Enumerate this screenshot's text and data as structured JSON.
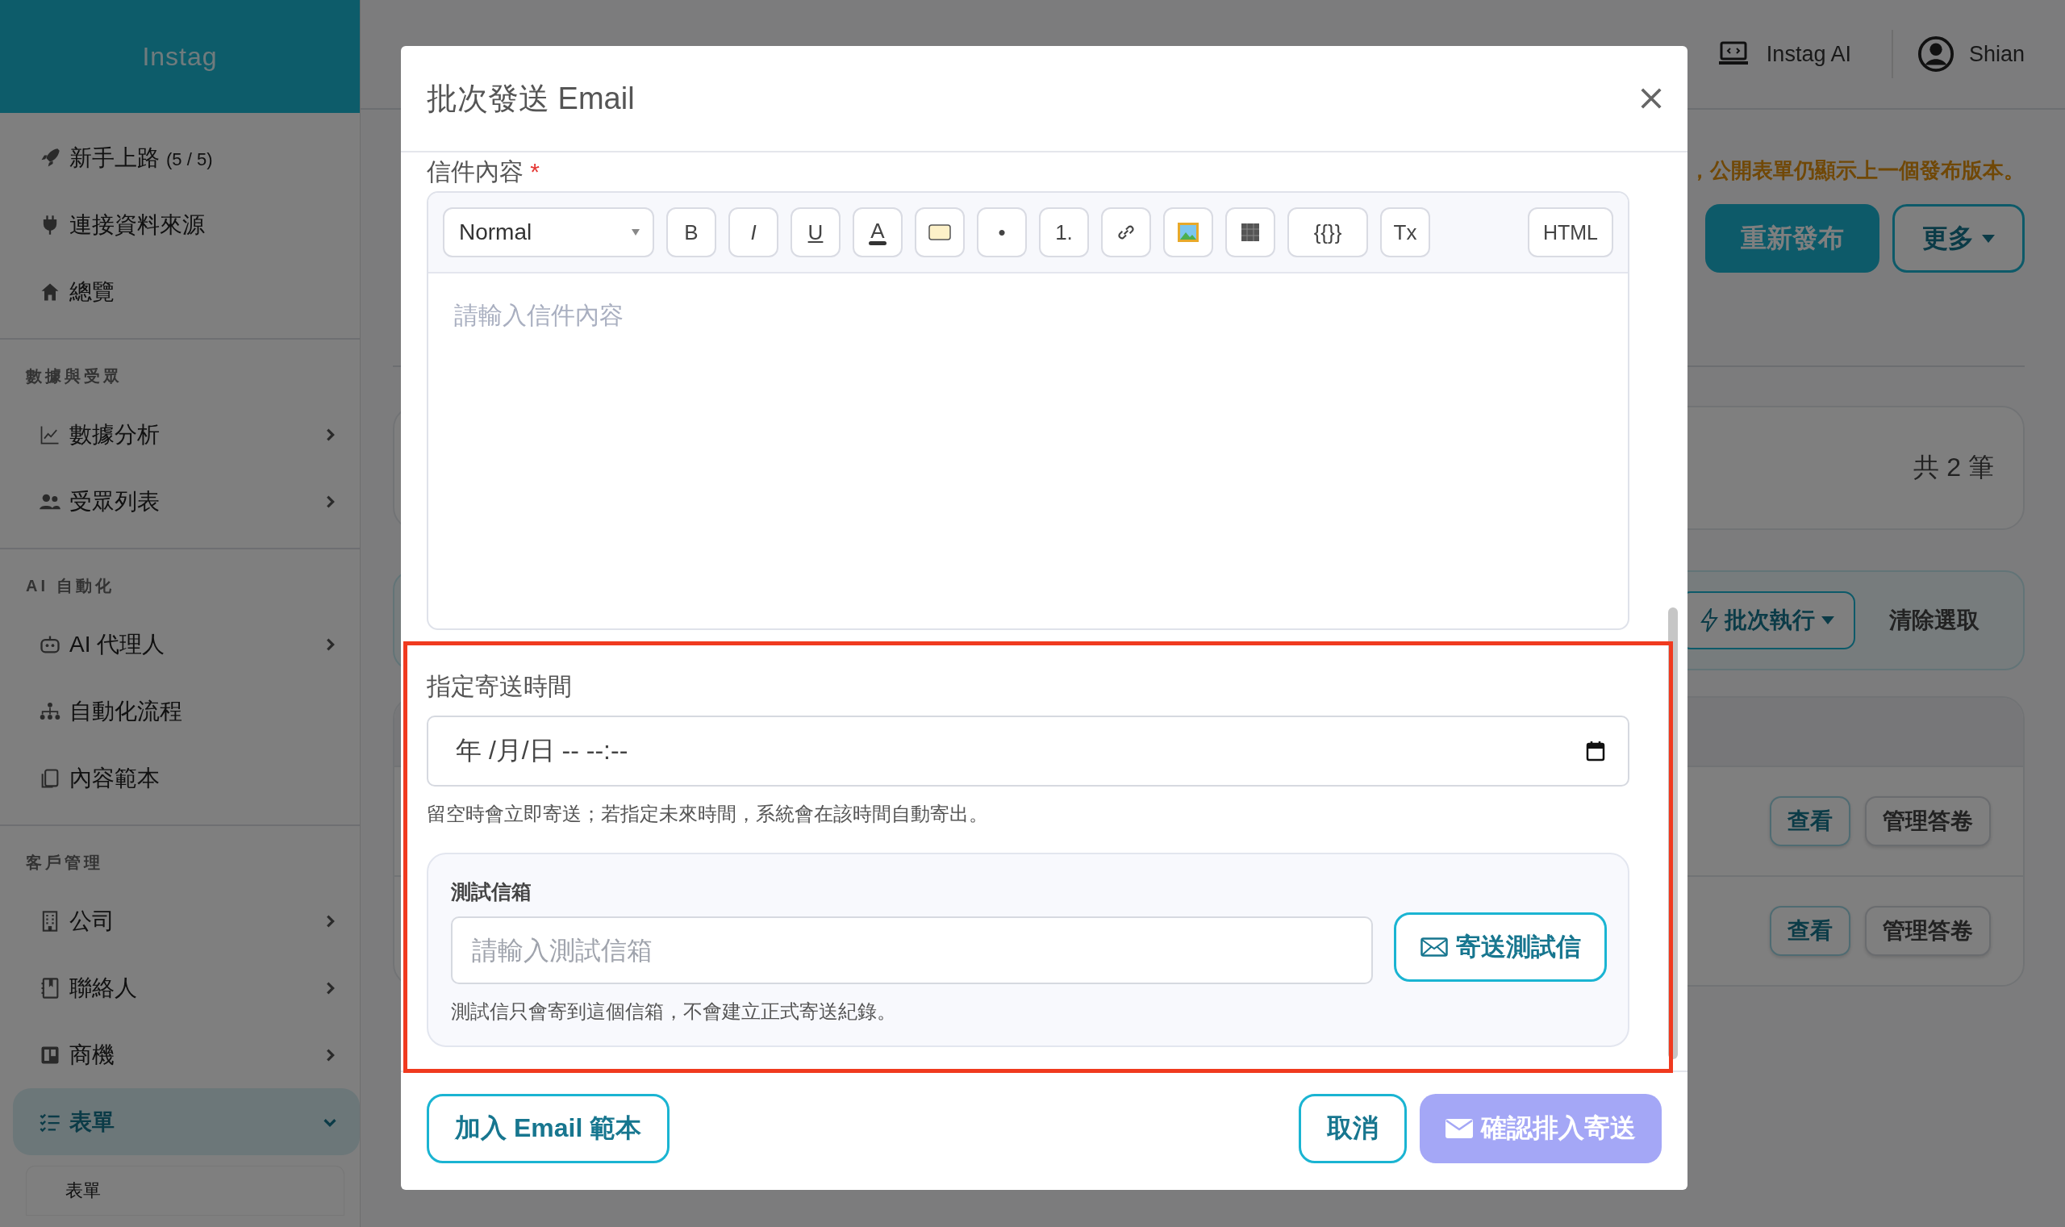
{
  "sidebar": {
    "brand": "Instag",
    "sections": [
      {
        "items": [
          {
            "label": "新手上路",
            "count": "(5 / 5)",
            "selected": false
          },
          {
            "label": "連接資料來源",
            "selected": false
          },
          {
            "label": "總覽",
            "selected": false
          }
        ]
      },
      {
        "title": "數據與受眾",
        "items": [
          {
            "label": "數據分析",
            "expanded": false,
            "selected": false
          },
          {
            "label": "受眾列表",
            "expanded": false,
            "selected": false
          }
        ]
      },
      {
        "title": "AI 自動化",
        "items": [
          {
            "label": "AI 代理人",
            "expanded": false,
            "selected": false
          },
          {
            "label": "自動化流程",
            "selected": false
          },
          {
            "label": "內容範本",
            "selected": false
          }
        ]
      },
      {
        "title": "客戶管理",
        "items": [
          {
            "label": "公司",
            "expanded": false,
            "selected": false
          },
          {
            "label": "聯絡人",
            "expanded": false,
            "selected": false
          },
          {
            "label": "商機",
            "expanded": false,
            "selected": false
          },
          {
            "label": "表單",
            "expanded": true,
            "selected": true,
            "children": [
              {
                "label": "表單",
                "selected": false
              }
            ]
          }
        ]
      }
    ]
  },
  "topbar": {
    "ai_label": "Instag AI",
    "user": "Shian"
  },
  "page": {
    "notice": "，公開表單仍顯示上一個發布版本。",
    "actions": [
      {
        "kind": "primary",
        "label": "重新發布"
      },
      {
        "kind": "dropdown",
        "label": "更多"
      }
    ],
    "summary": "共 2 筆",
    "batch": {
      "run": "批次執行",
      "clear": "清除選取"
    },
    "rows": [
      {
        "actions": [
          "查看",
          "管理答卷"
        ]
      },
      {
        "actions": [
          "查看",
          "管理答卷"
        ]
      }
    ]
  },
  "modal": {
    "title": "批次發送 Email",
    "content_label": "信件內容",
    "required_mark": "*",
    "toolbar": [
      {
        "kind": "select",
        "label": "Normal"
      },
      {
        "kind": "bold",
        "label": "B"
      },
      {
        "kind": "italic",
        "label": "I"
      },
      {
        "kind": "underline",
        "label": "U"
      },
      {
        "kind": "color",
        "label": "A"
      },
      {
        "kind": "highlight"
      },
      {
        "kind": "text",
        "label": "•"
      },
      {
        "kind": "text",
        "label": "1."
      },
      {
        "kind": "link"
      },
      {
        "kind": "image"
      },
      {
        "kind": "table"
      },
      {
        "kind": "wide",
        "label": "{{}}"
      },
      {
        "kind": "text",
        "label": "Tx"
      },
      {
        "kind": "html",
        "label": "HTML"
      }
    ],
    "editor_placeholder": "請輸入信件內容",
    "schedule": {
      "label": "指定寄送時間",
      "value": "年 /月/日 -- --:--",
      "hint": "留空時會立即寄送；若指定未來時間，系統會在該時間自動寄出。"
    },
    "test": {
      "label": "測試信箱",
      "placeholder": "請輸入測試信箱",
      "button": "寄送測試信",
      "hint": "測試信只會寄到這個信箱，不會建立正式寄送紀錄。"
    },
    "footer": {
      "template": "加入 Email 範本",
      "cancel": "取消",
      "confirm": {
        "label": "確認排入寄送",
        "disabled": true
      }
    }
  }
}
